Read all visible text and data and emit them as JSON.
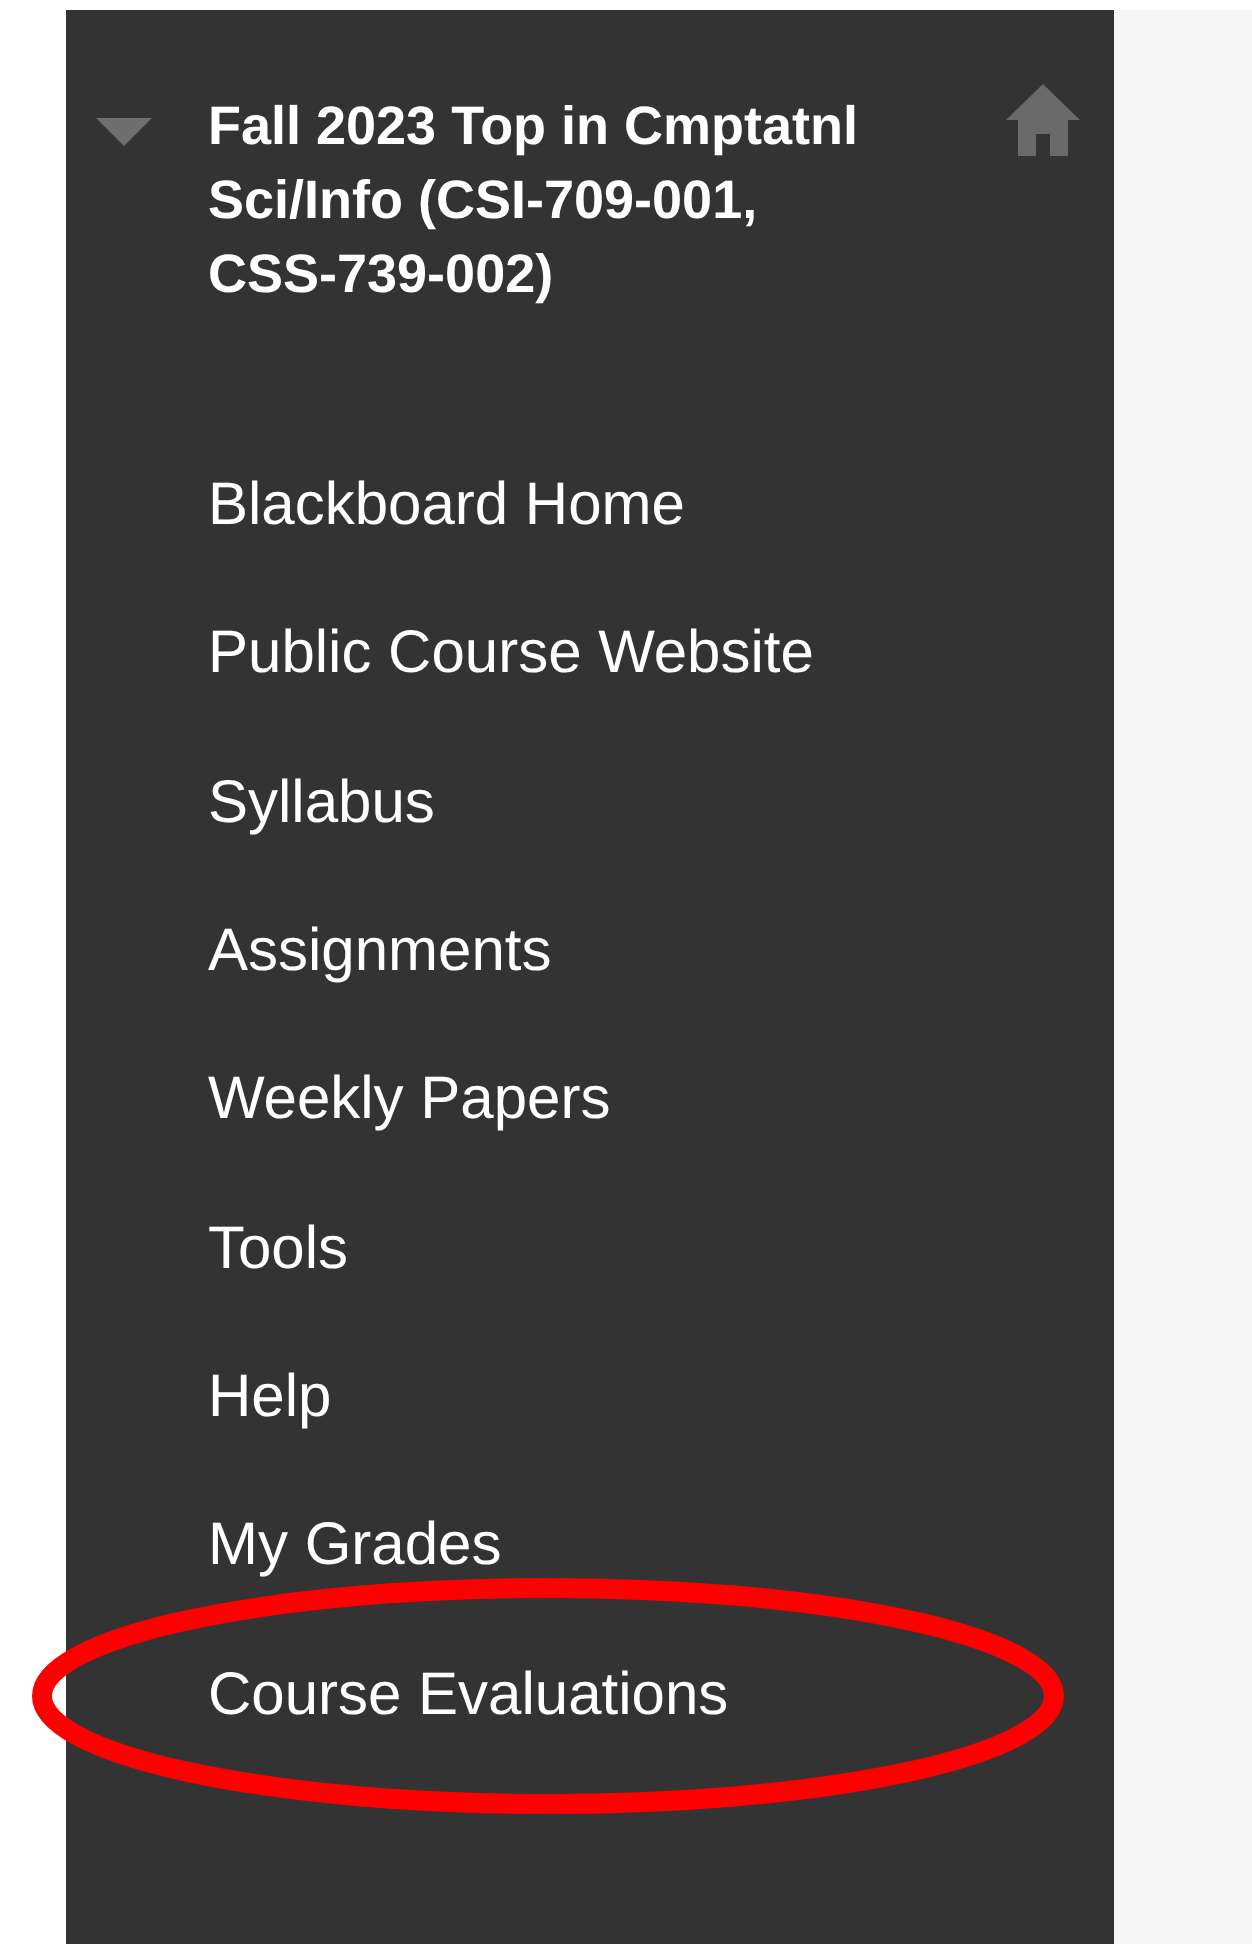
{
  "course_menu": {
    "title": "Fall 2023 Top in Cmptatnl Sci/Info (CSI-709-001, CSS-739-002)",
    "expanded": true,
    "items": [
      {
        "label": "Blackboard Home",
        "circled": false
      },
      {
        "label": "Public Course Website",
        "circled": false
      },
      {
        "label": "Syllabus",
        "circled": false
      },
      {
        "label": "Assignments",
        "circled": false
      },
      {
        "label": "Weekly Papers",
        "circled": false
      },
      {
        "label": "Tools",
        "circled": false
      },
      {
        "label": "Help",
        "circled": false
      },
      {
        "label": "My Grades",
        "circled": false
      },
      {
        "label": "Course Evaluations",
        "circled": true
      }
    ]
  }
}
